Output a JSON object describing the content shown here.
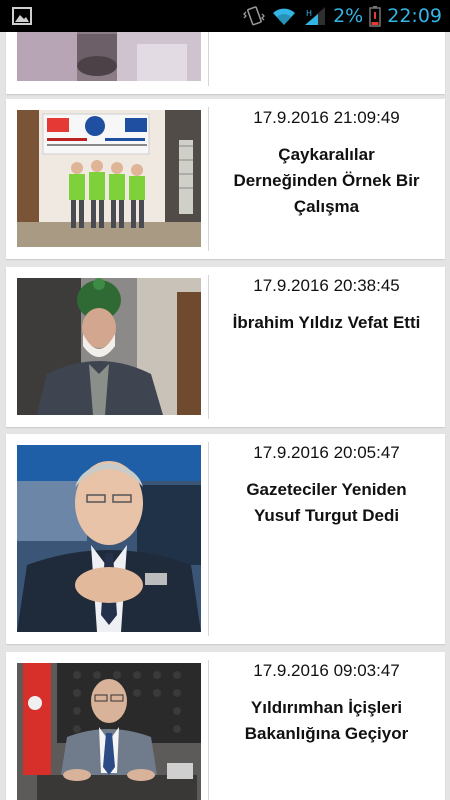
{
  "status_bar": {
    "battery_percent": "2%",
    "time": "22:09",
    "icons": [
      "image-notification-icon",
      "vibrate-icon",
      "wifi-icon",
      "signal-icon",
      "battery-low-icon"
    ],
    "accent_color": "#33b5e5",
    "battery_color": "#e53935"
  },
  "news": [
    {
      "date": "",
      "title": ""
    },
    {
      "date": "17.9.2016 21:09:49",
      "title": "Çaykaralılar Derneğinden Örnek Bir Çalışma"
    },
    {
      "date": "17.9.2016 20:38:45",
      "title": "İbrahim Yıldız Vefat Etti"
    },
    {
      "date": "17.9.2016 20:05:47",
      "title": "Gazeteciler Yeniden Yusuf Turgut Dedi"
    },
    {
      "date": "17.9.2016 09:03:47",
      "title": "Yıldırımhan İçişleri Bakanlığına Geçiyor"
    }
  ],
  "colors": {
    "background": "#e4e4e4",
    "card": "#ffffff",
    "status_bar": "#000000"
  }
}
